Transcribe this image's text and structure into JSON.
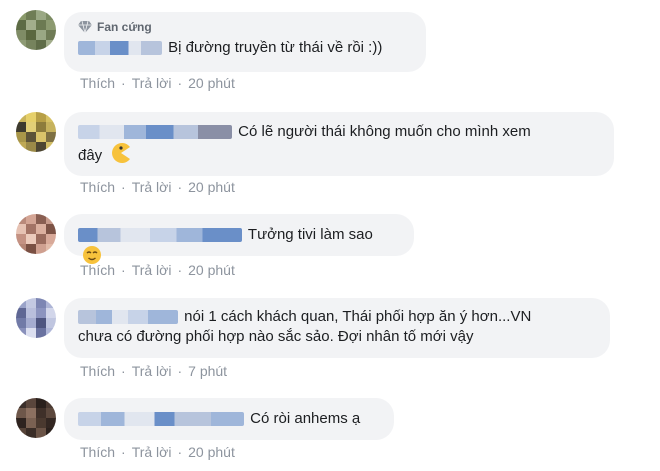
{
  "comments": [
    {
      "badge": "Fan cứng",
      "text": "Bị đường truyền từ thái về rồi :))",
      "like": "Thích",
      "reply": "Trả lời",
      "time": "20 phút"
    },
    {
      "text_line1": "Có lẽ người thái không muốn cho mình xem",
      "text_line2": "đây",
      "like": "Thích",
      "reply": "Trả lời",
      "time": "20 phút"
    },
    {
      "text": "Tưởng tivi làm sao",
      "like": "Thích",
      "reply": "Trả lời",
      "time": "20 phút"
    },
    {
      "text_line1": "nói 1 cách khách quan, Thái phối hợp ăn ý hơn...VN",
      "text_line2": "chưa có đường phối hợp nào sắc sảo. Đợi nhân tố mới vậy",
      "like": "Thích",
      "reply": "Trả lời",
      "time": "7 phút"
    },
    {
      "text": "Có ròi anhems ạ",
      "like": "Thích",
      "reply": "Trả lời",
      "time": "20 phút"
    }
  ],
  "colors": {
    "bubble": "#f2f3f5",
    "meta": "#8d949e",
    "pixelated_name": "#6a8fc8"
  }
}
